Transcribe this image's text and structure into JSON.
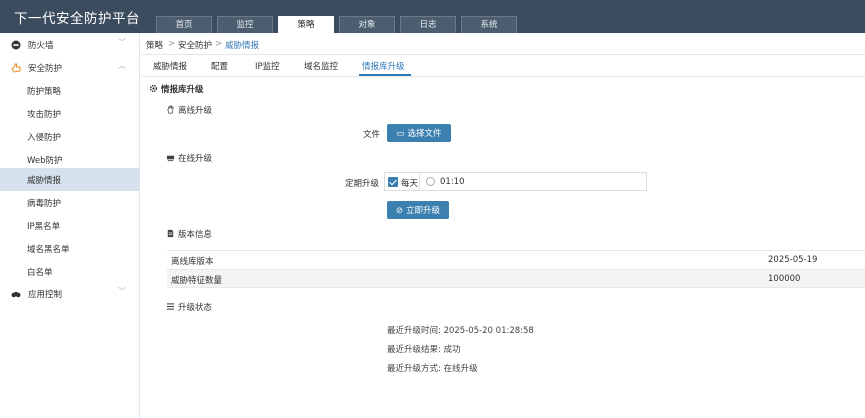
{
  "app": {
    "title": "下一代安全防护平台"
  },
  "top_tabs": [
    {
      "label": "首页",
      "active": false
    },
    {
      "label": "监控",
      "active": false
    },
    {
      "label": "策略",
      "active": true
    },
    {
      "label": "对象",
      "active": false
    },
    {
      "label": "日志",
      "active": false
    },
    {
      "label": "系统",
      "active": false
    }
  ],
  "sidebar": {
    "groups": [
      {
        "label": "防火墙",
        "icon": "minus-circle-icon",
        "expanded": false
      },
      {
        "label": "安全防护",
        "icon": "hand-pointer-icon",
        "expanded": true
      },
      {
        "label": "应用控制",
        "icon": "binoculars-icon",
        "expanded": false
      }
    ],
    "sub_items": [
      {
        "label": "防护策略",
        "active": false
      },
      {
        "label": "攻击防护",
        "active": false
      },
      {
        "label": "入侵防护",
        "active": false
      },
      {
        "label": "Web防护",
        "active": false
      },
      {
        "label": "威胁情报",
        "active": true
      },
      {
        "label": "病毒防护",
        "active": false
      },
      {
        "label": "IP黑名单",
        "active": false
      },
      {
        "label": "域名黑名单",
        "active": false
      },
      {
        "label": "白名单",
        "active": false
      }
    ]
  },
  "breadcrumb": {
    "items": [
      "策略",
      "安全防护",
      "威胁情报"
    ],
    "separator": ">"
  },
  "sub_tabs": [
    {
      "label": "威胁情报",
      "active": false
    },
    {
      "label": "配置",
      "active": false
    },
    {
      "label": "IP监控",
      "active": false
    },
    {
      "label": "域名监控",
      "active": false
    },
    {
      "label": "情报库升级",
      "active": true
    }
  ],
  "main": {
    "section_title": "情报库升级",
    "offline": {
      "title": "离线升级",
      "file_label": "文件",
      "choose_file_button": "选择文件"
    },
    "online": {
      "title": "在线升级",
      "schedule_label": "定期升级",
      "daily_label": "每天",
      "daily_checked": true,
      "time_value": "01:10",
      "upgrade_now_button": "立即升级"
    },
    "version": {
      "title": "版本信息",
      "rows": [
        {
          "key": "离线库版本",
          "value": "2025-05-19"
        },
        {
          "key": "威胁特征数量",
          "value": "100000"
        }
      ]
    },
    "status": {
      "title": "升级状态",
      "last_time": "最近升级时间: 2025-05-20 01:28:58",
      "last_result": "最近升级结果: 成功",
      "last_method": "最近升级方式: 在线升级"
    }
  },
  "colors": {
    "header_bg": "#3b4c5e",
    "accent": "#337ab7",
    "button": "#3c80b0",
    "sidebar_active": "#d6e1ee"
  }
}
